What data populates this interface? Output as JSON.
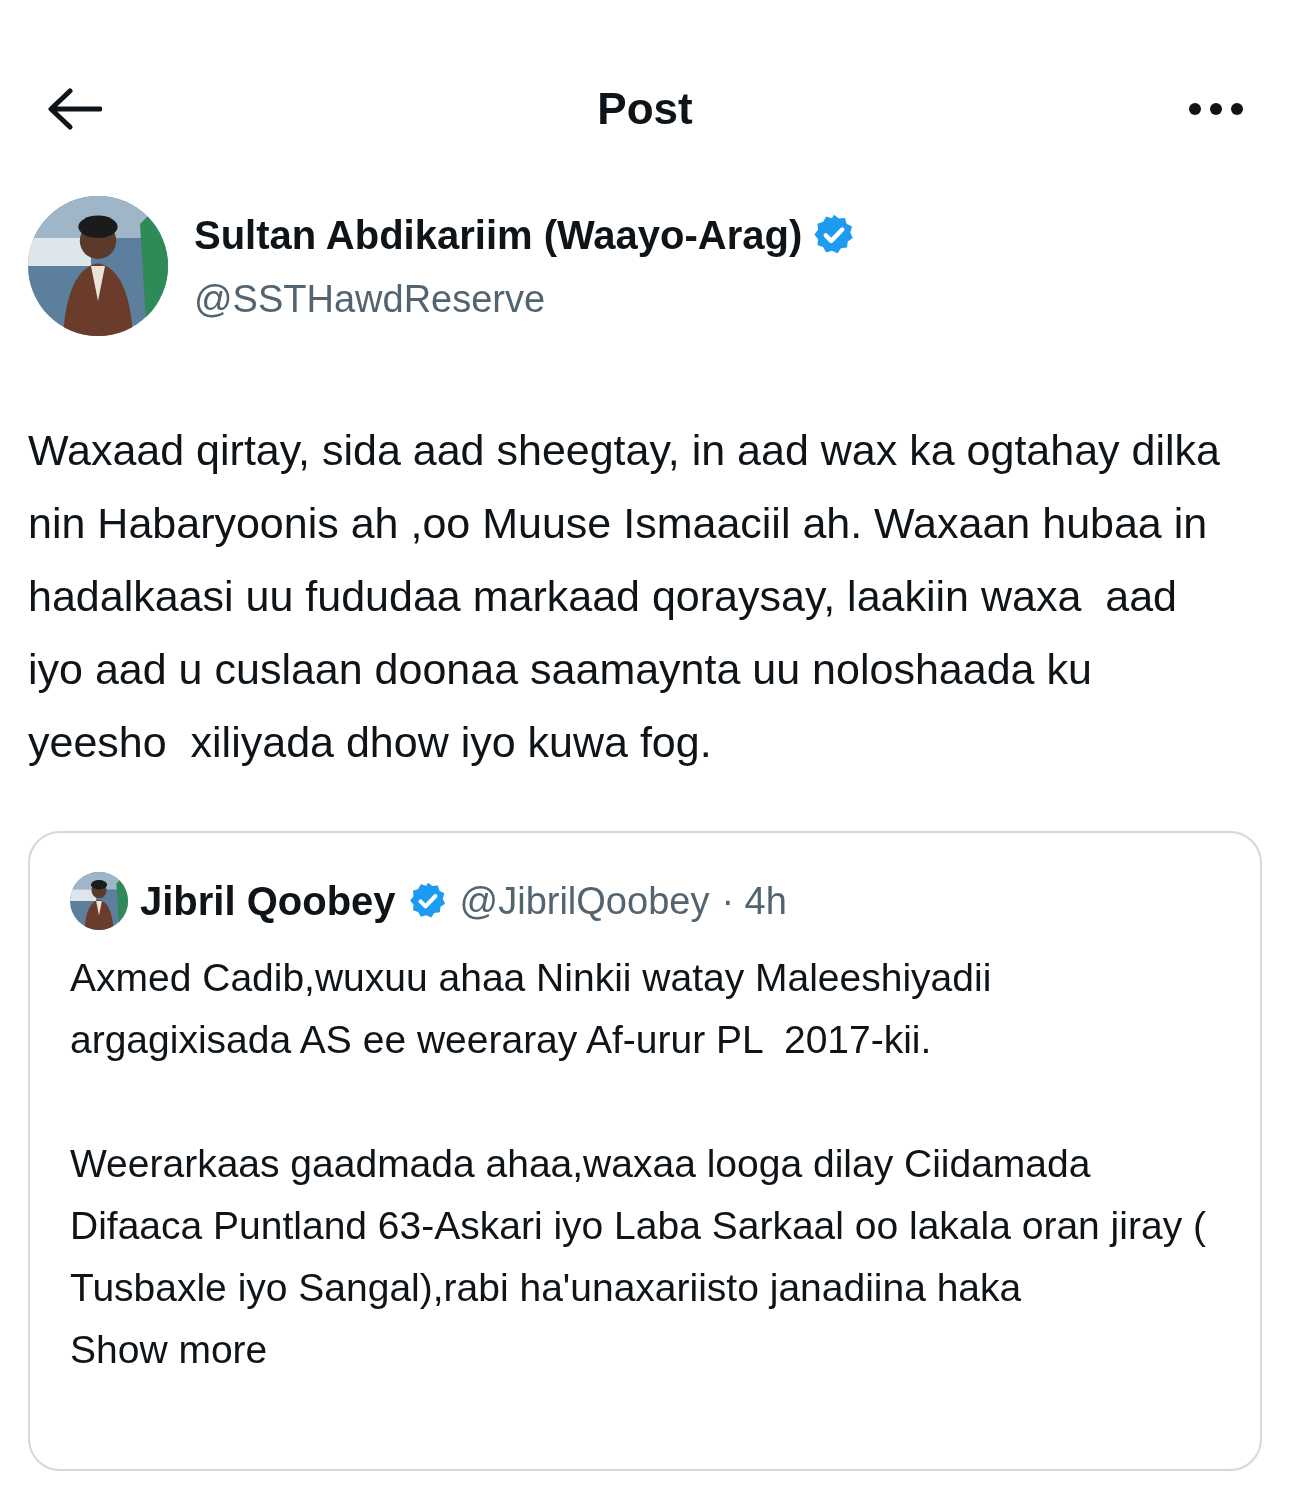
{
  "header": {
    "title": "Post"
  },
  "author": {
    "name": "Sultan Abdikariim (Waayo-Arag)",
    "verified": true,
    "handle": "@SSTHawdReserve"
  },
  "body": "Waxaad qirtay, sida aad sheegtay, in aad wax ka ogtahay dilka nin Habaryoonis ah ,oo Muuse Ismaaciil ah. Waxaan hubaa in hadalkaasi uu fududaa markaad qoraysay, laakiin waxa  aad iyo aad u cuslaan doonaa saamaynta uu noloshaada ku yeesho  xiliyada dhow iyo kuwa fog.",
  "quote": {
    "name": "Jibril Qoobey",
    "verified": true,
    "handle": "@JibrilQoobey",
    "time": "· 4h",
    "paragraphs": [
      "Axmed Cadib,wuxuu ahaa Ninkii watay Maleeshiyadii argagixisada AS ee weeraray Af-urur PL  2017-kii.",
      "Weerarkaas gaadmada ahaa,waxaa looga dilay Ciidamada Difaaca Puntland 63-Askari iyo Laba Sarkaal oo lakala oran jiray ( Tusbaxle iyo Sangal),rabi ha'unaxariisto janadiina haka"
    ],
    "more": "Show more"
  }
}
